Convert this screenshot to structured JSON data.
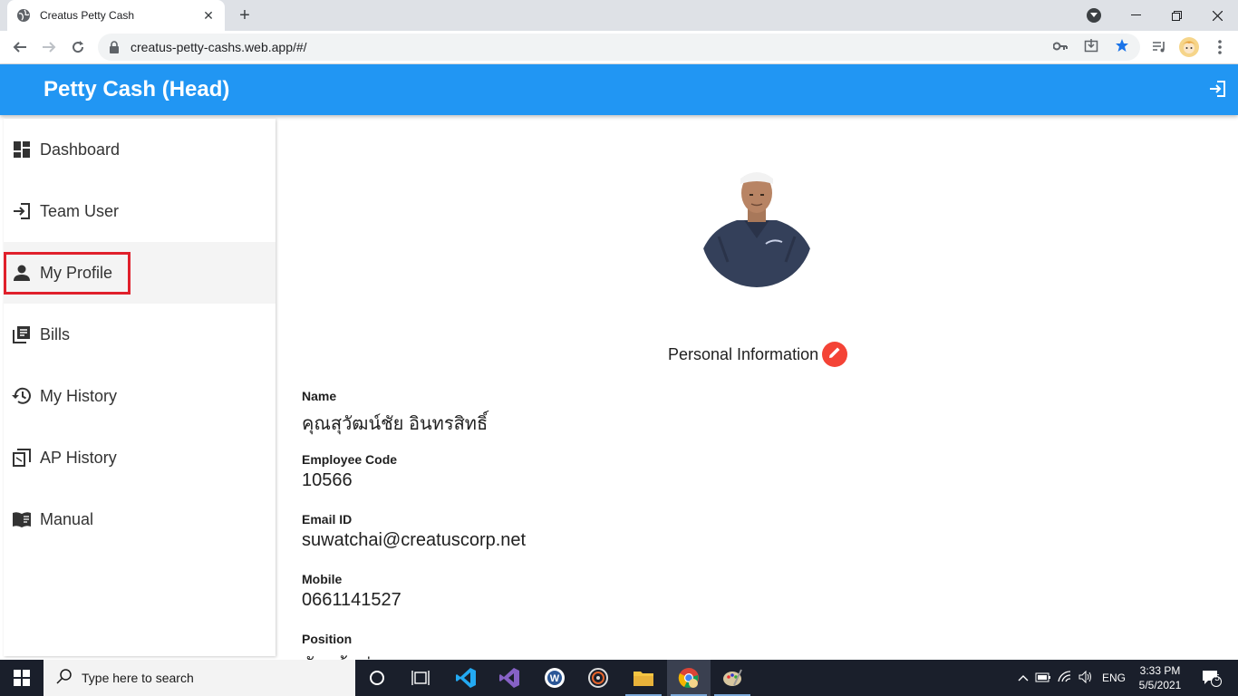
{
  "browser": {
    "tab_title": "Creatus Petty Cash",
    "url": "creatus-petty-cashs.web.app/#/"
  },
  "app": {
    "title": "Petty Cash (Head)",
    "accent_color": "#2196f3"
  },
  "sidebar": {
    "items": [
      {
        "label": "Dashboard",
        "icon": "dashboard-icon"
      },
      {
        "label": "Team User",
        "icon": "login-icon"
      },
      {
        "label": "My Profile",
        "icon": "person-icon",
        "active": true
      },
      {
        "label": "Bills",
        "icon": "library-books-icon"
      },
      {
        "label": "My History",
        "icon": "history-icon"
      },
      {
        "label": "AP History",
        "icon": "receipt-icon"
      },
      {
        "label": "Manual",
        "icon": "book-icon"
      }
    ]
  },
  "profile": {
    "section_title": "Personal Information",
    "fields": [
      {
        "label": "Name",
        "value": "คุณสุวัฒน์ชัย   อินทรสิทธิ์"
      },
      {
        "label": "Employee Code",
        "value": "10566"
      },
      {
        "label": "Email ID",
        "value": "suwatchai@creatuscorp.net"
      },
      {
        "label": "Mobile",
        "value": "0661141527"
      },
      {
        "label": "Position",
        "value": "หัวหน้าช่าง"
      }
    ]
  },
  "taskbar": {
    "search_placeholder": "Type here to search",
    "language": "ENG",
    "time": "3:33 PM",
    "date": "5/5/2021",
    "notification_count": "5"
  }
}
